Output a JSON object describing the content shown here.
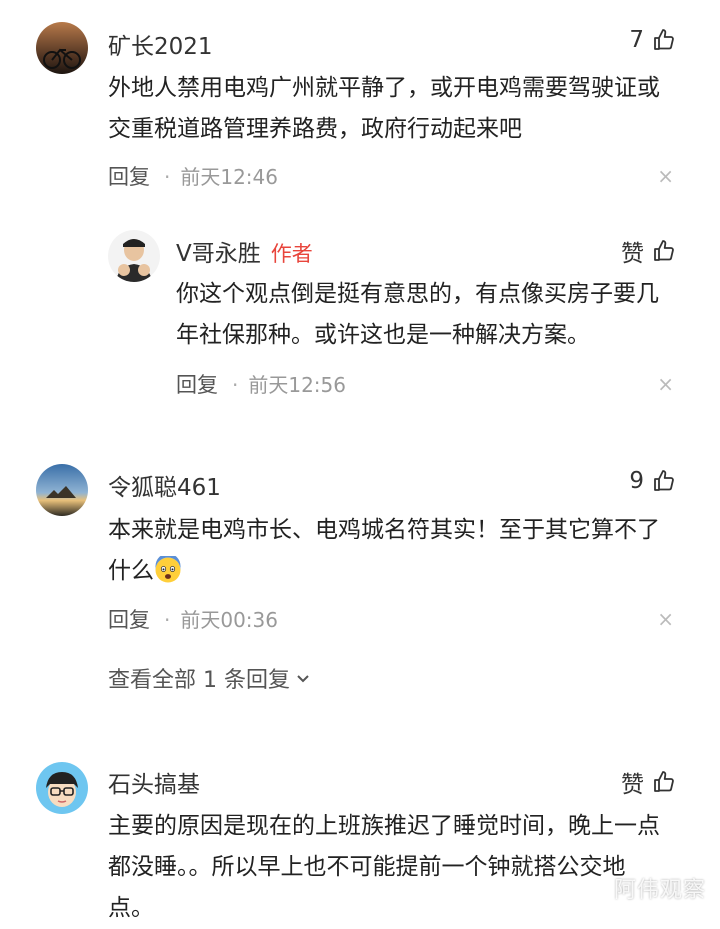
{
  "comments": [
    {
      "username": "矿长2021",
      "like_count": "7",
      "text_line1": "外地人禁用电鸡广州就平静了，或开电鸡需要驾驶证或",
      "text_line2": "交重税道路管理养路费，政府行动起来吧",
      "reply_label": "回复",
      "time": "前天12:46"
    },
    {
      "username": "V哥永胜",
      "author_tag": "作者",
      "like_label": "赞",
      "text_line1": "你这个观点倒是挺有意思的，有点像买房子要几",
      "text_line2": "年社保那种。或许这也是一种解决方案。",
      "reply_label": "回复",
      "time": "前天12:56"
    },
    {
      "username": "令狐聪461",
      "like_count": "9",
      "text_line1": "本来就是电鸡市长、电鸡城名符其实！至于其它算不了",
      "text_line2": "什么",
      "emoji": "😨",
      "reply_label": "回复",
      "time": "前天00:36",
      "view_all": "查看全部 1 条回复"
    },
    {
      "username": "石头搞基",
      "like_label": "赞",
      "text_line1": "主要的原因是现在的上班族推迟了睡觉时间，晚上一点",
      "text_line2": "都没睡。。所以早上也不可能提前一个钟就搭公交地",
      "text_line3": "点。"
    }
  ],
  "close_glyph": "×",
  "watermark": "阿伟观察",
  "colors": {
    "author_tag": "#e8453c",
    "meta": "#999999"
  }
}
